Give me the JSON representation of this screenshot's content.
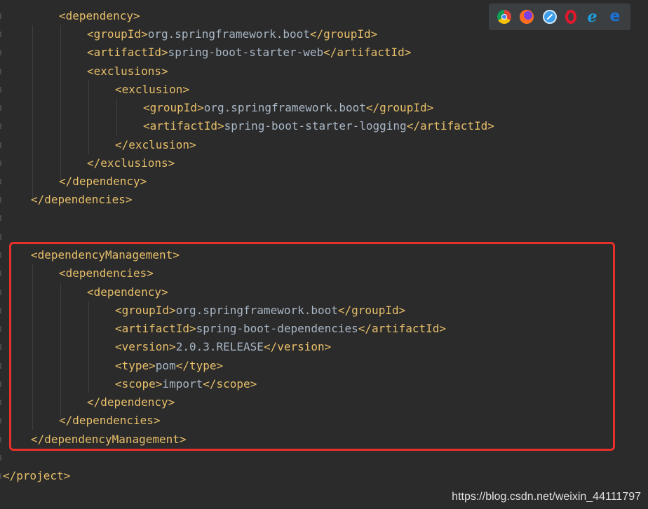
{
  "code_lines": [
    {
      "open": "<dependency>",
      "text": "",
      "close": ""
    },
    {
      "open": "<groupId>",
      "text": "org.springframework.boot",
      "close": "</groupId>"
    },
    {
      "open": "<artifactId>",
      "text": "spring-boot-starter-web",
      "close": "</artifactId>"
    },
    {
      "open": "<exclusions>",
      "text": "",
      "close": ""
    },
    {
      "open": "<exclusion>",
      "text": "",
      "close": ""
    },
    {
      "open": "<groupId>",
      "text": "org.springframework.boot",
      "close": "</groupId>"
    },
    {
      "open": "<artifactId>",
      "text": "spring-boot-starter-logging",
      "close": "</artifactId>"
    },
    {
      "open": "</exclusion>",
      "text": "",
      "close": ""
    },
    {
      "open": "</exclusions>",
      "text": "",
      "close": ""
    },
    {
      "open": "</dependency>",
      "text": "",
      "close": ""
    },
    {
      "open": "</dependencies>",
      "text": "",
      "close": ""
    },
    {
      "open": "",
      "text": "",
      "close": ""
    },
    {
      "open": "",
      "text": "",
      "close": ""
    },
    {
      "open": "<dependencyManagement>",
      "text": "",
      "close": ""
    },
    {
      "open": "<dependencies>",
      "text": "",
      "close": ""
    },
    {
      "open": "<dependency>",
      "text": "",
      "close": ""
    },
    {
      "open": "<groupId>",
      "text": "org.springframework.boot",
      "close": "</groupId>"
    },
    {
      "open": "<artifactId>",
      "text": "spring-boot-dependencies",
      "close": "</artifactId>"
    },
    {
      "open": "<version>",
      "text": "2.0.3.RELEASE",
      "close": "</version>"
    },
    {
      "open": "<type>",
      "text": "pom",
      "close": "</type>"
    },
    {
      "open": "<scope>",
      "text": "import",
      "close": "</scope>"
    },
    {
      "open": "</dependency>",
      "text": "",
      "close": ""
    },
    {
      "open": "</dependencies>",
      "text": "",
      "close": ""
    },
    {
      "open": "</dependencyManagement>",
      "text": "",
      "close": ""
    },
    {
      "open": "",
      "text": "",
      "close": ""
    },
    {
      "open": "</project>",
      "text": "",
      "close": ""
    }
  ],
  "browser_icons": [
    "chrome-icon",
    "firefox-icon",
    "safari-icon",
    "opera-icon",
    "ie-icon",
    "edge-icon"
  ],
  "ie_glyph": "e",
  "edge_glyph": "e",
  "watermark": "https://blog.csdn.net/weixin_44111797",
  "colors": {
    "tag": "#e8bf6a",
    "text": "#a9b7c6",
    "background": "#2b2b2b",
    "highlight_border": "#e8302a"
  }
}
